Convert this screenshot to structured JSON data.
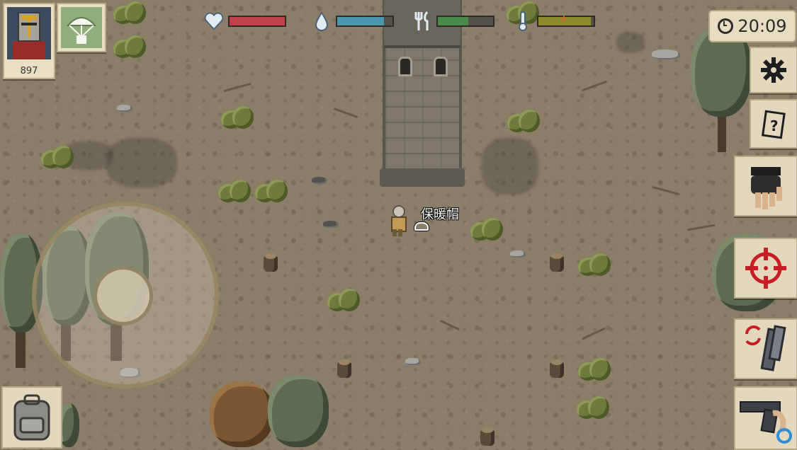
{
  "player": {
    "score": "897",
    "portrait": "crusader-helmet-portrait"
  },
  "ability": {
    "icon": "parachute-airdrop-icon"
  },
  "stats": {
    "health": {
      "icon": "heart-icon",
      "level": 1.0,
      "color": "#c2424a"
    },
    "thirst": {
      "icon": "water-drop-icon",
      "level": 0.85,
      "color": "#4a98b0"
    },
    "hunger": {
      "icon": "fork-knife-icon",
      "level": 0.55,
      "color": "#4a8a4a"
    },
    "temperature": {
      "icon": "thermometer-icon",
      "level": 0.95,
      "color": "#8c8a2a",
      "marker": "+"
    }
  },
  "clock": {
    "time": "20:09",
    "icon": "clock-icon"
  },
  "side_menu": [
    {
      "name": "settings-button",
      "icon": "gear-icon"
    },
    {
      "name": "quests-button",
      "icon": "notepad-icon"
    }
  ],
  "actions": [
    {
      "name": "melee-attack-button",
      "icon": "fist-glove-icon"
    },
    {
      "name": "aim-button",
      "icon": "crosshair-icon"
    },
    {
      "name": "reload-button",
      "icon": "magazine-reload-icon"
    },
    {
      "name": "switch-weapon-button",
      "icon": "pistol-icon"
    }
  ],
  "world": {
    "ground_item_label": "保暖帽",
    "ground_item_icon": "warm-hat-icon"
  },
  "inventory": {
    "icon": "backpack-icon"
  },
  "colors": {
    "panel": "#e3d8bd",
    "ground": "#8b7d68",
    "crosshair": "#c81d25"
  }
}
